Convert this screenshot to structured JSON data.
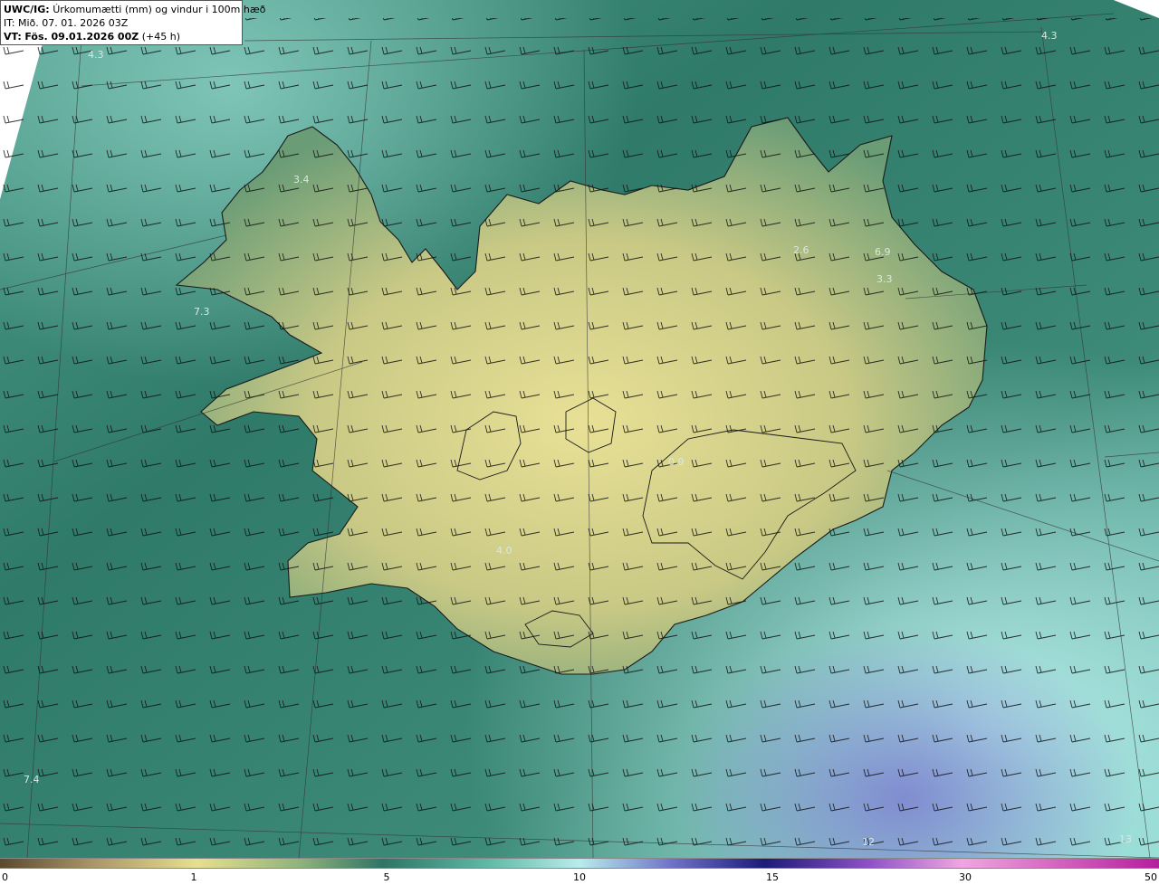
{
  "infobox": {
    "product": "UWC/IG:",
    "field": "Úrkomumætti (mm) og vindur i 100m hæð",
    "it_line": "IT: Mið. 07. 01. 2026 03Z",
    "vt_label": "VT:",
    "vt_value": "Fös. 09.01.2026 00Z",
    "lead": "(+45 h)"
  },
  "colorbar": {
    "ticks": [
      "0",
      "1",
      "5",
      "10",
      "15",
      "30",
      "50"
    ],
    "stops": [
      {
        "color": "#5a4a2e",
        "offset": 0.0
      },
      {
        "color": "#a99668",
        "offset": 0.08
      },
      {
        "color": "#e6df8e",
        "offset": 0.17
      },
      {
        "color": "#8fb27a",
        "offset": 0.26
      },
      {
        "color": "#2e7565",
        "offset": 0.33
      },
      {
        "color": "#5fb8a5",
        "offset": 0.42
      },
      {
        "color": "#b8ecec",
        "offset": 0.5
      },
      {
        "color": "#6f72c8",
        "offset": 0.58
      },
      {
        "color": "#1c1b78",
        "offset": 0.66
      },
      {
        "color": "#8e52c8",
        "offset": 0.75
      },
      {
        "color": "#f0a6e0",
        "offset": 0.83
      },
      {
        "color": "#b51e9e",
        "offset": 1.0
      }
    ]
  },
  "map_labels": [
    "4.3",
    "4.3",
    "3.4",
    "7.3",
    "2.6",
    "6.9",
    "3.3",
    "0.9",
    "4.0",
    "7.4",
    "12",
    "13"
  ],
  "colors": {
    "sea": "#2f7a68",
    "land_high": "#e4dc8f",
    "land_low": "#7fa878",
    "coast": "#1a1a1a",
    "barb": "#111111"
  }
}
